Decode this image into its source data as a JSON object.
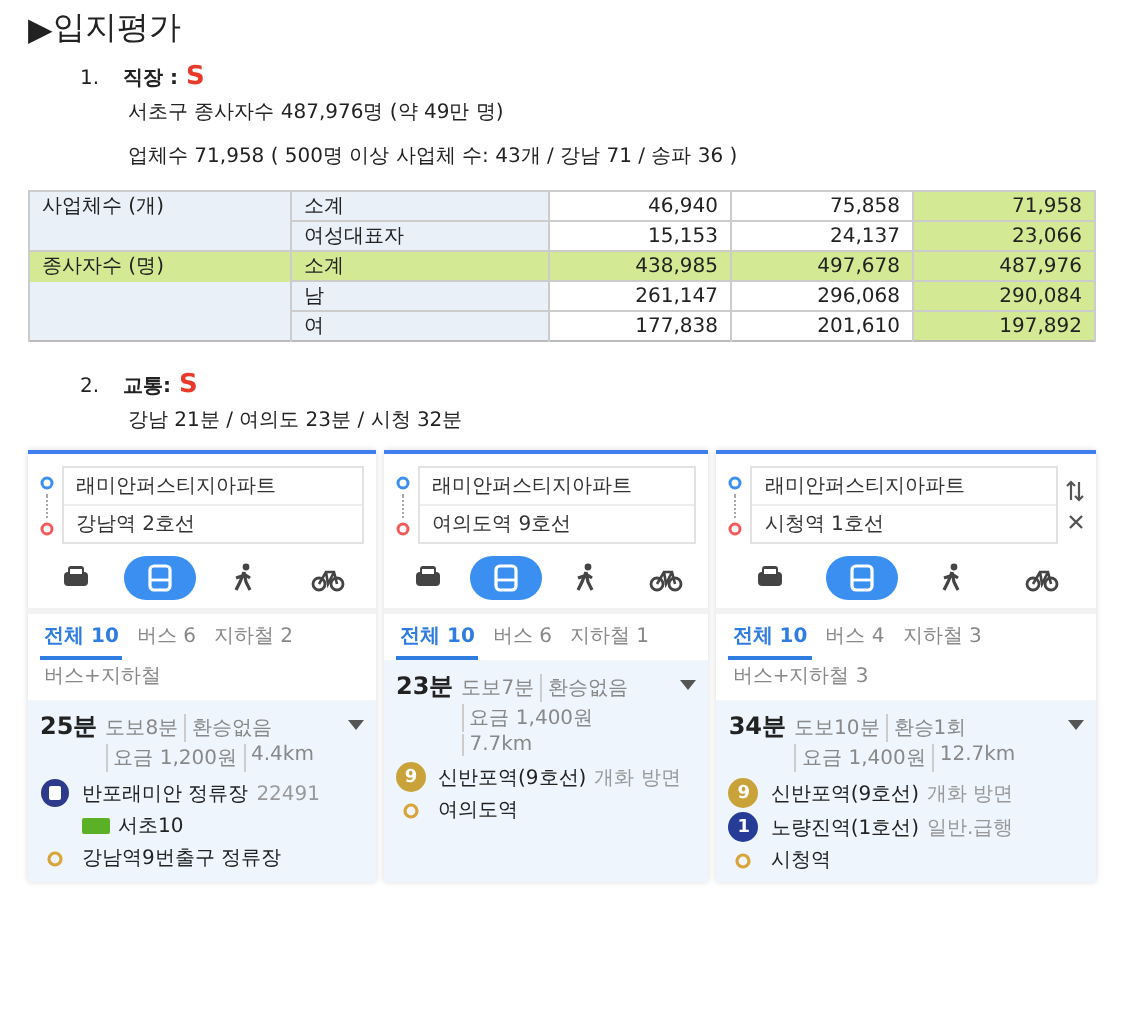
{
  "heading": {
    "marker": "▶",
    "title": "입지평가"
  },
  "section_1": {
    "number": "1.",
    "title": "직장 :",
    "grade": "S",
    "lines": [
      "서초구 종사자수 487,976명 (약 49만 명)",
      "업체수 71,958 ( 500명 이상 사업체 수: 43개 / 강남 71 / 송파 36 )"
    ]
  },
  "table": {
    "value_columns": [
      {
        "highlighted": false
      },
      {
        "highlighted": false
      },
      {
        "highlighted": true
      }
    ],
    "groups": [
      {
        "label": "사업체수 (개)",
        "rows": [
          {
            "label": "소계",
            "highlighted": false,
            "values": [
              "46,940",
              "75,858",
              "71,958"
            ]
          },
          {
            "label": "여성대표자",
            "highlighted": false,
            "values": [
              "15,153",
              "24,137",
              "23,066"
            ]
          }
        ]
      },
      {
        "label": "종사자수 (명)",
        "rows": [
          {
            "label": "소계",
            "highlighted": true,
            "values": [
              "438,985",
              "497,678",
              "487,976"
            ]
          },
          {
            "label": "남",
            "highlighted": false,
            "values": [
              "261,147",
              "296,068",
              "290,084"
            ]
          },
          {
            "label": "여",
            "highlighted": false,
            "values": [
              "177,838",
              "201,610",
              "197,892"
            ]
          }
        ]
      }
    ]
  },
  "section_2": {
    "number": "2.",
    "title": "교통:",
    "grade": "S",
    "lines": [
      "강남 21분 / 여의도 23분 / 시청 32분"
    ]
  },
  "route_panels": [
    {
      "origin": "래미안퍼스티지아파트",
      "destination": "강남역 2호선",
      "show_controls": false,
      "modes": [
        {
          "kind": "car",
          "selected": false
        },
        {
          "kind": "bus",
          "selected": true
        },
        {
          "kind": "walk",
          "selected": false
        },
        {
          "kind": "bike",
          "selected": false
        }
      ],
      "tabs": [
        {
          "label": "전체 10",
          "selected": true
        },
        {
          "label": "버스 6",
          "selected": false
        },
        {
          "label": "지하철 2",
          "selected": false
        },
        {
          "label": "버스+지하철",
          "selected": false
        }
      ],
      "result": {
        "duration": "25분",
        "meta": [
          "도보8분",
          "환승없음",
          "요금 1,200원",
          "4.4km"
        ],
        "steps": [
          {
            "kind": "bus",
            "name": "반포래미안 정류장",
            "note": "22491",
            "route": "서초10"
          },
          {
            "kind": "end",
            "name": "강남역9번출구 정류장"
          }
        ]
      }
    },
    {
      "origin": "래미안퍼스티지아파트",
      "destination": "여의도역 9호선",
      "show_controls": false,
      "modes": [
        {
          "kind": "car",
          "selected": false
        },
        {
          "kind": "bus",
          "selected": true
        },
        {
          "kind": "walk",
          "selected": false
        },
        {
          "kind": "bike",
          "selected": false
        }
      ],
      "tabs": [
        {
          "label": "전체 10",
          "selected": true
        },
        {
          "label": "버스 6",
          "selected": false
        },
        {
          "label": "지하철 1",
          "selected": false
        }
      ],
      "result": {
        "duration": "23분",
        "meta": [
          "도보7분",
          "환승없음",
          "요금 1,400원",
          "7.7km"
        ],
        "steps": [
          {
            "kind": "subway",
            "line": "9",
            "color": "#c9a33a",
            "name": "신반포역(9호선)",
            "note": "개화 방면"
          },
          {
            "kind": "end",
            "name": "여의도역"
          }
        ]
      }
    },
    {
      "origin": "래미안퍼스티지아파트",
      "destination": "시청역 1호선",
      "show_controls": true,
      "modes": [
        {
          "kind": "car",
          "selected": false
        },
        {
          "kind": "bus",
          "selected": true
        },
        {
          "kind": "walk",
          "selected": false
        },
        {
          "kind": "bike",
          "selected": false
        }
      ],
      "tabs": [
        {
          "label": "전체 10",
          "selected": true
        },
        {
          "label": "버스 4",
          "selected": false
        },
        {
          "label": "지하철 3",
          "selected": false
        },
        {
          "label": "버스+지하철 3",
          "selected": false
        }
      ],
      "result": {
        "duration": "34분",
        "meta": [
          "도보10분",
          "환승1회",
          "요금 1,400원",
          "12.7km"
        ],
        "steps": [
          {
            "kind": "subway",
            "line": "9",
            "color": "#c9a33a",
            "name": "신반포역(9호선)",
            "note": "개화 방면"
          },
          {
            "kind": "subway",
            "line": "1",
            "color": "#263c96",
            "name": "노량진역(1호선)",
            "note": "일반.급행"
          },
          {
            "kind": "end",
            "name": "시청역"
          }
        ]
      }
    }
  ]
}
